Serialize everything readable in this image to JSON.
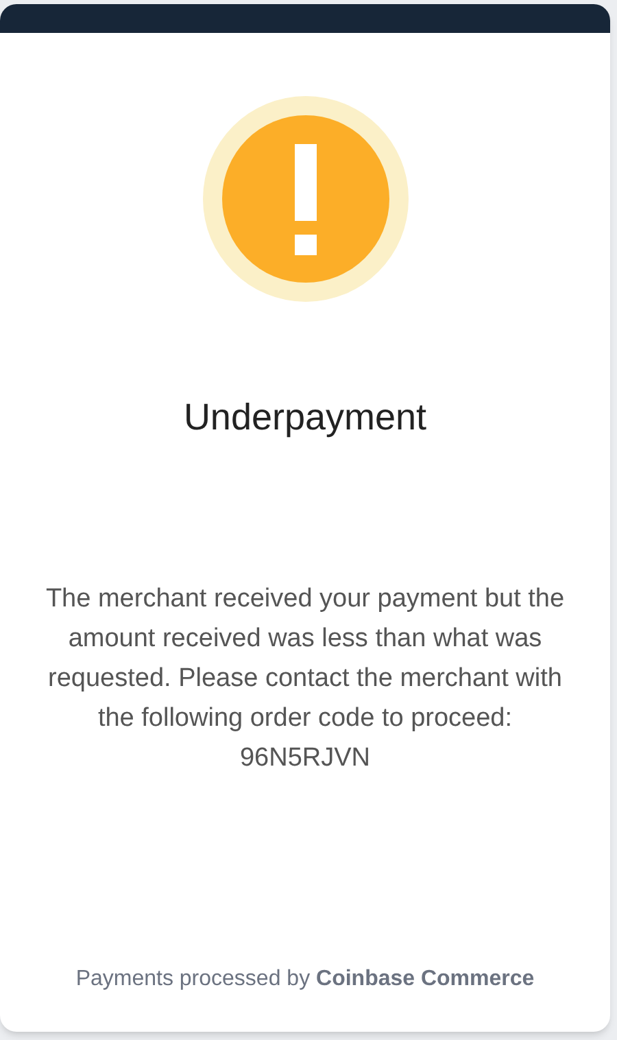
{
  "status": {
    "kind": "warning"
  },
  "title": "Underpayment",
  "message": "The merchant received your payment but the amount received was less than what was requested. Please contact the merchant with the following order code to proceed:",
  "order_code": "96N5RJVN",
  "footer": "Payments processed by **Coinbase Commerce**"
}
